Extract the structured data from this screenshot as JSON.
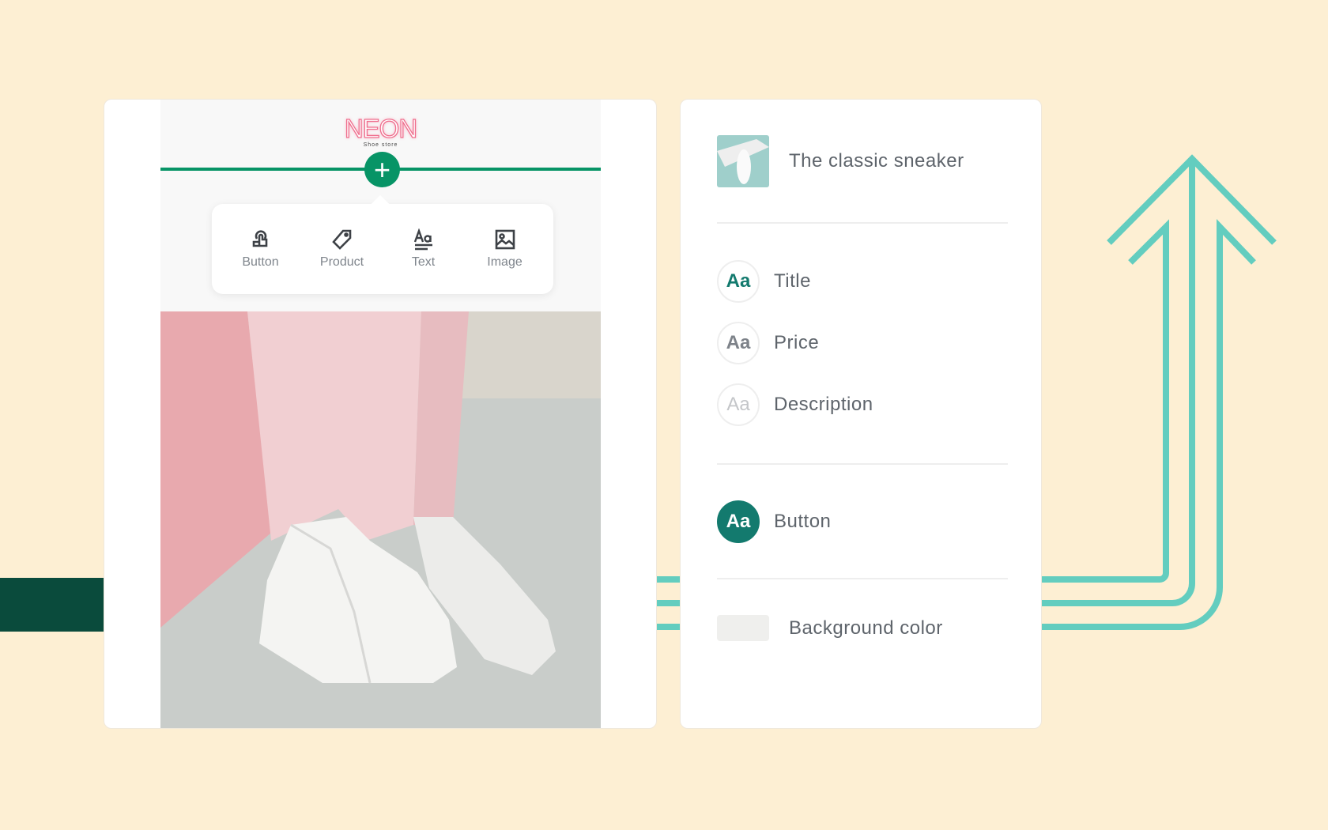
{
  "colors": {
    "background": "#fdefd3",
    "accent_green": "#079466",
    "dark_teal": "#137a6e",
    "teal_lines": "#63cdbf",
    "dark_bar": "#0a4b3c"
  },
  "preview": {
    "logo": "NEON",
    "tagline": "Shoe store",
    "add_icon": "plus-icon",
    "popup_items": [
      {
        "label": "Button",
        "icon": "tap-hand-icon"
      },
      {
        "label": "Product",
        "icon": "tag-icon"
      },
      {
        "label": "Text",
        "icon": "text-aa-icon"
      },
      {
        "label": "Image",
        "icon": "image-icon"
      }
    ]
  },
  "panel": {
    "product_title": "The classic sneaker",
    "text_styles": [
      {
        "label": "Title",
        "glyph": "Aa"
      },
      {
        "label": "Price",
        "glyph": "Aa"
      },
      {
        "label": "Description",
        "glyph": "Aa"
      }
    ],
    "button_style": {
      "label": "Button",
      "glyph": "Aa"
    },
    "background_color_label": "Background color"
  }
}
